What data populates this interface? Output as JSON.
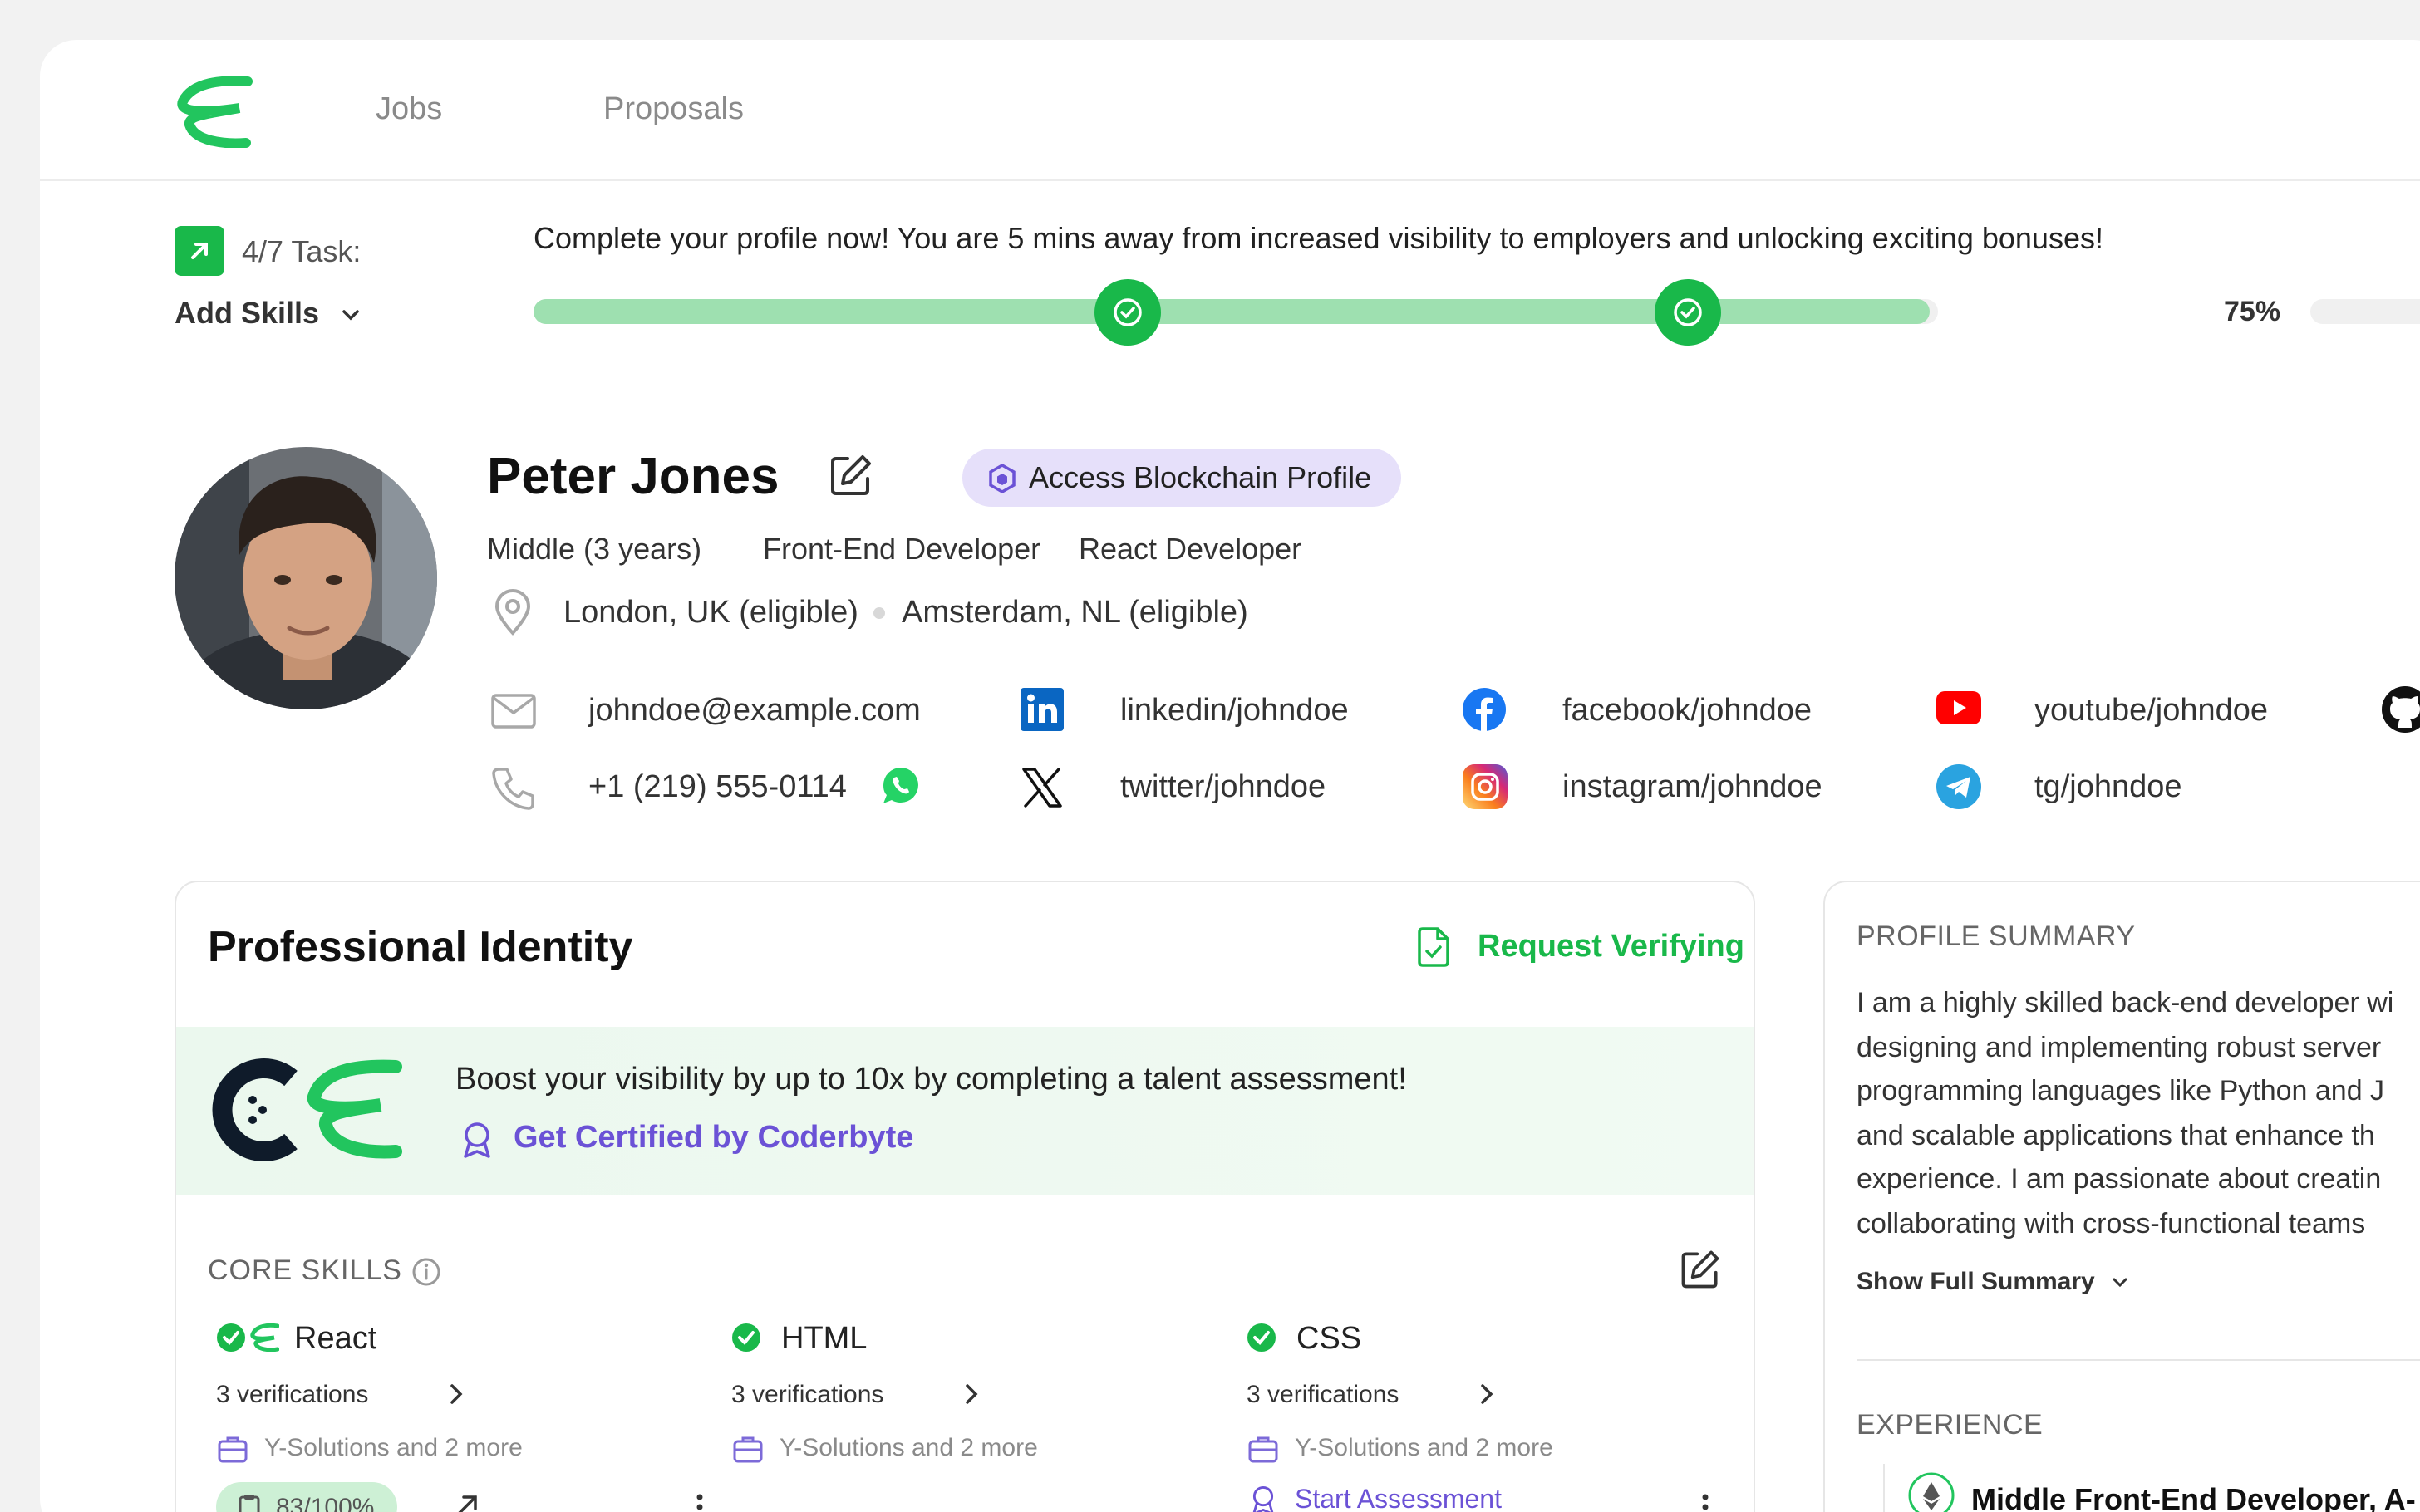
{
  "nav": {
    "links": [
      "Jobs",
      "Proposals"
    ]
  },
  "task": {
    "counter": "4/7 Task:",
    "current": "Add Skills"
  },
  "progress": {
    "message": "Complete your profile now! You are 5 mins away from increased visibility to employers and unlocking exciting bonuses!",
    "percent_label": "75%",
    "fill_fraction": 0.75
  },
  "profile": {
    "name": "Peter Jones",
    "blockchain_label": "Access Blockchain Profile",
    "level": "Middle (3 years)",
    "roles": [
      "Front-End Developer",
      "React Developer"
    ],
    "locations": [
      "London, UK (eligible)",
      "Amsterdam, NL (eligible)"
    ],
    "contacts": {
      "email": "johndoe@example.com",
      "phone": "+1 (219) 555-0114",
      "linkedin": "linkedin/johndoe",
      "twitter": "twitter/johndoe",
      "facebook": "facebook/johndoe",
      "instagram": "instagram/johndoe",
      "youtube": "youtube/johndoe",
      "telegram": "tg/johndoe"
    }
  },
  "identity": {
    "title": "Professional Identity",
    "request_label": "Request Verifying",
    "boost_text": "Boost your visibility by up to 10x by completing a talent assessment!",
    "cert_label": "Get Certified by Coderbyte",
    "core_skills_label": "CORE SKILLS",
    "skills": [
      {
        "name": "React",
        "verifications": "3 verifications",
        "companies": "Y-Solutions and 2 more",
        "score": "83/100%"
      },
      {
        "name": "HTML",
        "verifications": "3 verifications",
        "companies": "Y-Solutions and 2 more"
      },
      {
        "name": "CSS",
        "verifications": "3 verifications",
        "companies": "Y-Solutions and 2 more",
        "action": "Start Assessment"
      }
    ]
  },
  "summary": {
    "label": "PROFILE SUMMARY",
    "lines": [
      "I am a highly skilled back-end developer wi",
      "designing and implementing robust server",
      "programming languages like Python and J",
      "and scalable applications that enhance th",
      "experience. I am passionate about creatin",
      "collaborating with cross-functional teams"
    ],
    "show_full": "Show Full Summary",
    "experience_label": "EXPERIENCE",
    "experience_title": "Middle Front-End Developer, A-"
  },
  "colors": {
    "accent_green": "#19b84a",
    "progress_fill": "#9ee0b0",
    "purple": "#6b52d6",
    "chip_bg": "#e6e0fa"
  }
}
